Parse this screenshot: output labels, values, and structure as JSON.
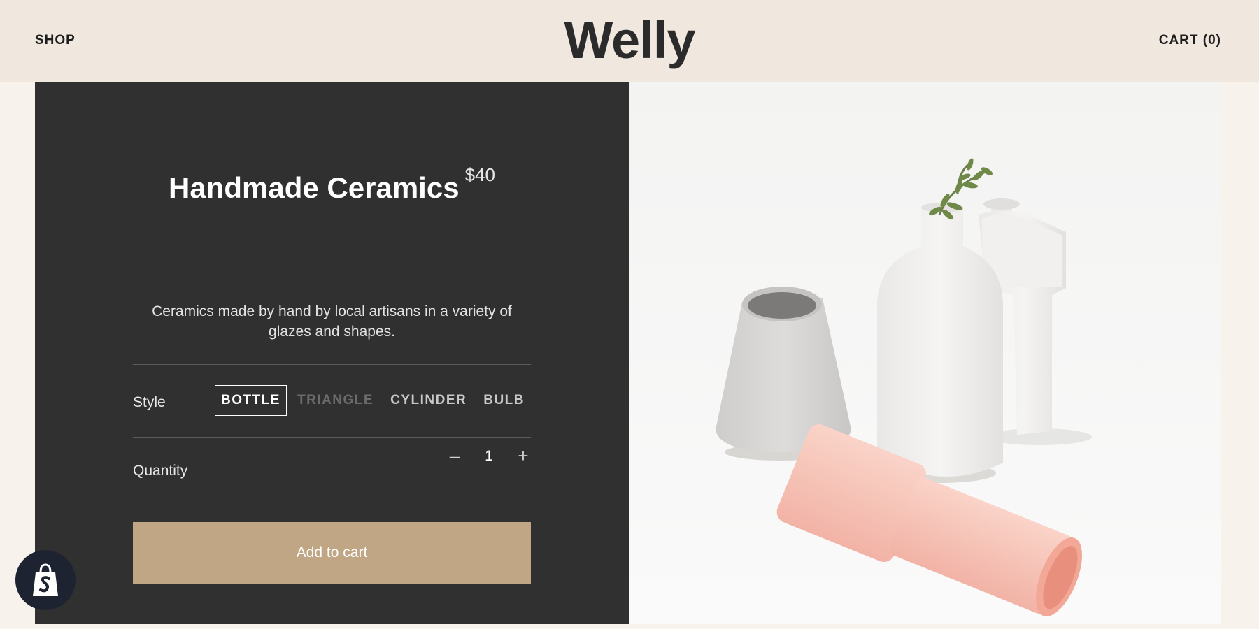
{
  "header": {
    "shop_label": "SHOP",
    "logo": "Welly",
    "cart_label": "CART (0)"
  },
  "product": {
    "title": "Handmade Ceramics",
    "price": "$40",
    "description": "Ceramics made by hand by local artisans in a variety of glazes and shapes.",
    "style_label": "Style",
    "styles": [
      {
        "label": "BOTTLE",
        "state": "selected"
      },
      {
        "label": "TRIANGLE",
        "state": "disabled"
      },
      {
        "label": "CYLINDER",
        "state": "available"
      },
      {
        "label": "BULB",
        "state": "available"
      }
    ],
    "quantity_label": "Quantity",
    "quantity_minus": "–",
    "quantity_value": "1",
    "quantity_plus": "+",
    "add_to_cart": "Add to cart"
  },
  "colors": {
    "header_bg": "#f0e7df",
    "panel_bg": "#313030",
    "button_bg": "#c0a685",
    "badge_bg": "#1d2330"
  },
  "icons": {
    "badge": "shopify-bag-icon"
  }
}
